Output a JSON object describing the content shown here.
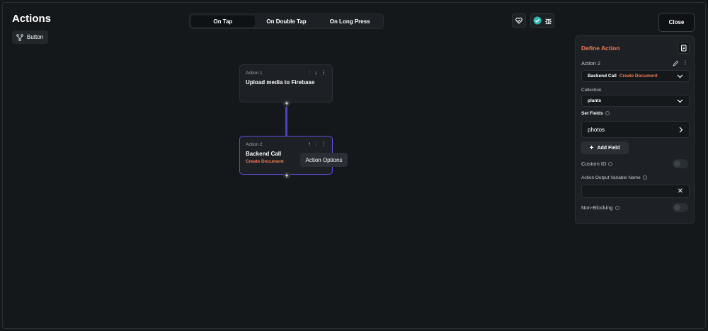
{
  "header": {
    "title": "Actions",
    "chip_label": "Button",
    "close_label": "Close"
  },
  "tabs": [
    {
      "label": "On Tap",
      "active": true
    },
    {
      "label": "On Double Tap",
      "active": false
    },
    {
      "label": "On Long Press",
      "active": false
    }
  ],
  "nodes": [
    {
      "label": "Action 1",
      "title": "Upload media to Firebase",
      "subtitle": ""
    },
    {
      "label": "Action 2",
      "title": "Backend Call",
      "subtitle": "Create Document"
    }
  ],
  "tooltip": "Action Options",
  "panel": {
    "title": "Define Action",
    "action_label": "Action 2",
    "action_select": {
      "primary": "Backend Call",
      "secondary": "Create Document"
    },
    "collection_label": "Collection",
    "collection_value": "plants",
    "set_fields_label": "Set Fields",
    "field_item": "photos",
    "add_field_label": "Add Field",
    "custom_id_label": "Custom ID",
    "output_var_label": "Action Output Variable Name",
    "output_var_value": "",
    "non_blocking_label": "Non-Blocking"
  },
  "colors": {
    "accent_orange": "#f07b54",
    "connector_purple": "#4b3fd0",
    "selected_border": "#5b4fd6",
    "teal_icon": "#2fb5b0"
  },
  "icons": [
    "branch-icon",
    "heart-icon",
    "check-circle-icon",
    "bug-icon",
    "arrow-up-icon",
    "arrow-down-icon",
    "more-vertical-icon",
    "plus-icon",
    "edit-icon",
    "chevron-down-icon",
    "chevron-right-icon",
    "clear-icon",
    "document-icon",
    "info-icon"
  ]
}
